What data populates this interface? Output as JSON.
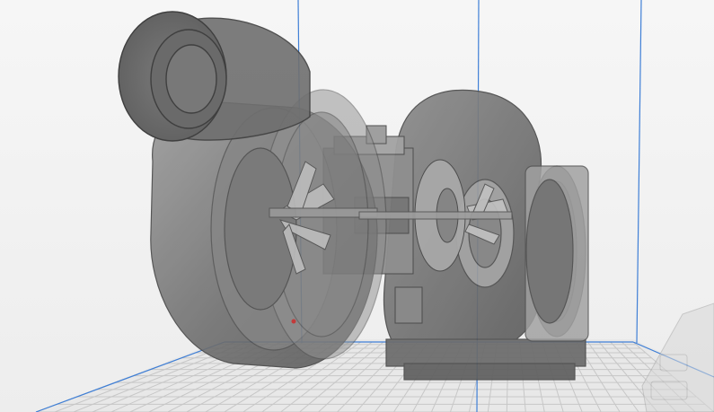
{
  "app": {
    "view": "3d-print-preview"
  },
  "scene": {
    "model": "turbocharger",
    "background_color": "#f4f4f4",
    "grid_line_color": "#c7c7c7",
    "build_volume_edge_color": "#3f7fd6",
    "model_fill_color": "#7a7a7a",
    "model_edge_color": "#4a4a4a"
  }
}
